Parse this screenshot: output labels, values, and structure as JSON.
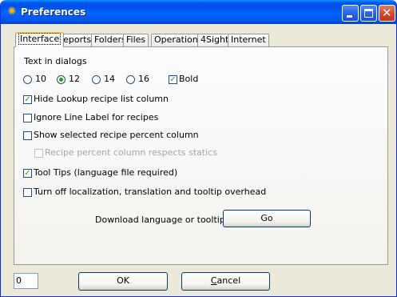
{
  "window": {
    "title": "Preferences",
    "icon": "app-icon"
  },
  "tabs": [
    {
      "label": "Interface",
      "active": true
    },
    {
      "label": "Reports"
    },
    {
      "label": "Folders"
    },
    {
      "label": "Files"
    },
    {
      "label": "Operations"
    },
    {
      "label": "4Sight"
    },
    {
      "label": "Internet"
    }
  ],
  "interface": {
    "text_in_dialogs_label": "Text in dialogs",
    "font_sizes": [
      {
        "label": "10",
        "checked": false
      },
      {
        "label": "12",
        "checked": true
      },
      {
        "label": "14",
        "checked": false
      },
      {
        "label": "16",
        "checked": false
      }
    ],
    "bold": {
      "label": "Bold",
      "checked": true
    },
    "options": [
      {
        "label": "Hide Lookup recipe list column",
        "checked": true
      },
      {
        "label": "Ignore Line Label for recipes",
        "checked": false
      },
      {
        "label": "Show selected recipe percent column",
        "checked": false
      },
      {
        "label": "Recipe percent column respects statics",
        "checked": false,
        "disabled": true
      },
      {
        "label": "Tool Tips (language file required)",
        "checked": true
      },
      {
        "label": "Turn off localization, translation and tooltip overhead",
        "checked": false
      }
    ],
    "download_label": "Download language or tooltips file",
    "go_button": "Go"
  },
  "footer": {
    "input_value": "0",
    "ok_button": "OK",
    "cancel_button_prefix": "",
    "cancel_button_mnemonic": "C",
    "cancel_button_rest": "ancel"
  }
}
